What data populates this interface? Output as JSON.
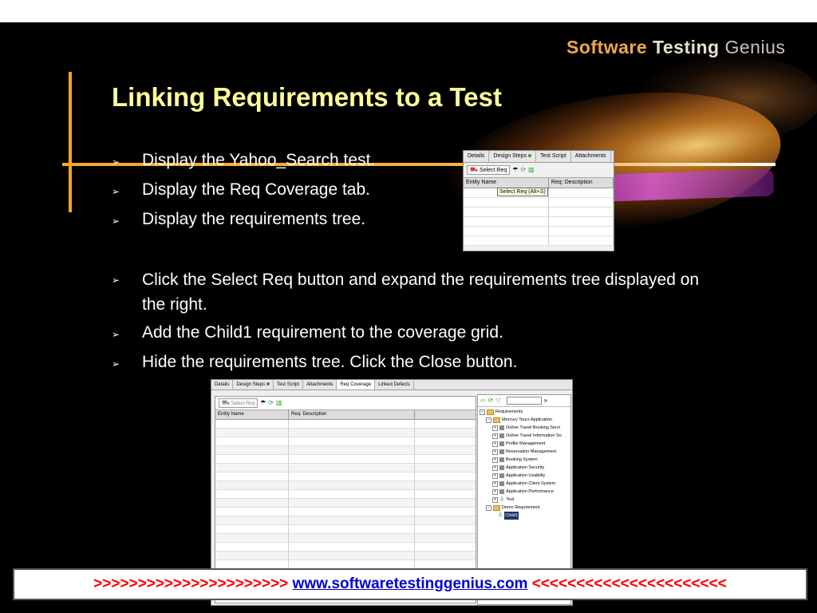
{
  "logo": {
    "word1": "Software",
    "word2": "Testing",
    "word3": "Genius"
  },
  "title": "Linking Requirements to a Test",
  "bullets": [
    "Display the Yahoo_Search test.",
    "Display the Req Coverage tab.",
    "Display the requirements tree.",
    "Click the Select Req button and expand the requirements tree displayed on the right.",
    "Add the Child1 requirement to the coverage grid.",
    "Hide the requirements tree. Click the Close button."
  ],
  "shot1": {
    "tabs": [
      "Details",
      "Design Steps",
      "Test Script",
      "Attachments"
    ],
    "select_req": "Select Req",
    "tooltip": "Select Req (Alt+S)",
    "columns": [
      "Entity Name",
      "Req: Description"
    ]
  },
  "shot2": {
    "tabs": [
      "Details",
      "Design Steps",
      "Test Script",
      "Attachments",
      "Req Coverage",
      "Linked Defects"
    ],
    "select_req": "Select Req",
    "columns": [
      "Entity Name",
      "Req: Description"
    ],
    "tree": {
      "root": "Requirements",
      "group1": "Mercury Tours Application",
      "group1_children": [
        "Online Travel Booking Servi",
        "Online Travel Information So",
        "Profile Management",
        "Reservation Management",
        "Booking System",
        "Application Security",
        "Application Usability",
        "Application Client System",
        "Application Performance",
        "Test"
      ],
      "group2": "Demo Requirement",
      "group2_child": "Child1"
    }
  },
  "footer": {
    "left_arrows": ">>>>>>>>>>>>>>>>>>>>>>",
    "url": "www.softwaretestinggenius.com",
    "right_arrows": "<<<<<<<<<<<<<<<<<<<<<<"
  }
}
